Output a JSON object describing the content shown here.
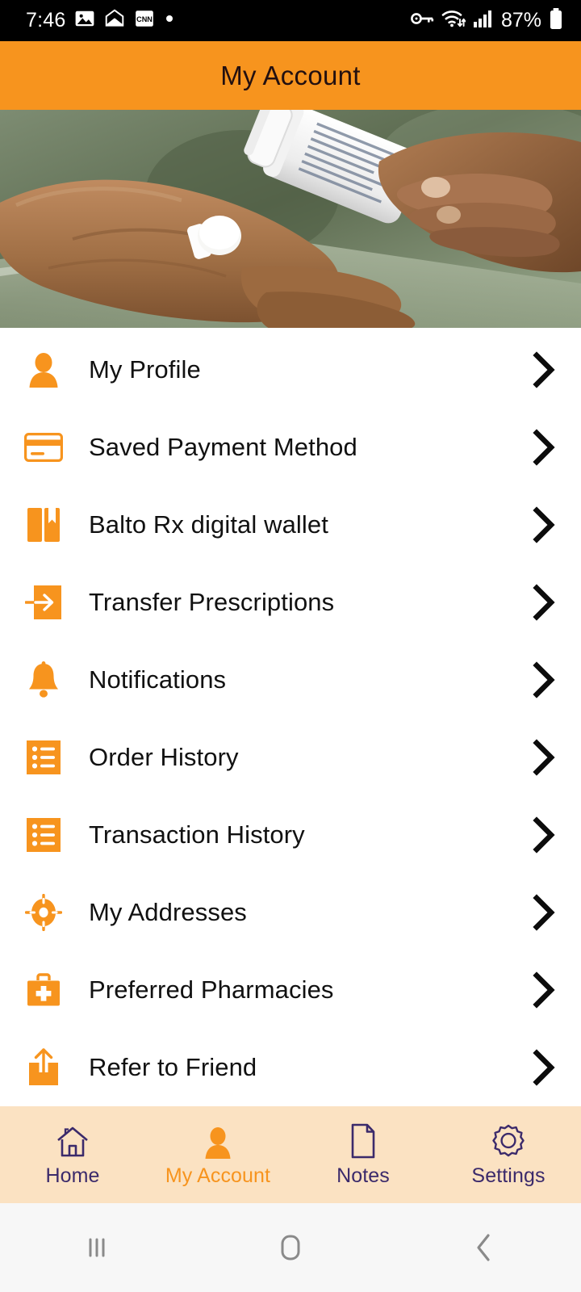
{
  "status_bar": {
    "time": "7:46",
    "battery_percent": "87%",
    "left_icons": [
      "image-icon",
      "envelope-icon",
      "cnn-icon",
      "dot-icon"
    ],
    "right_icons": [
      "vpn-key-icon",
      "wifi-icon",
      "cellular-signal-icon",
      "battery-icon"
    ]
  },
  "header": {
    "title": "My Account"
  },
  "hero": {
    "alt": "hands-pouring-pills-from-bottle-photo"
  },
  "menu": {
    "items": [
      {
        "label": "My Profile",
        "icon": "person-icon",
        "chevron": "chevron-right-icon"
      },
      {
        "label": "Saved Payment Method",
        "icon": "credit-card-icon",
        "chevron": "chevron-right-icon"
      },
      {
        "label": "Balto Rx digital wallet",
        "icon": "wallet-book-icon",
        "chevron": "chevron-right-icon"
      },
      {
        "label": "Transfer Prescriptions",
        "icon": "arrow-in-box-icon",
        "chevron": "chevron-right-icon"
      },
      {
        "label": "Notifications",
        "icon": "bell-icon",
        "chevron": "chevron-right-icon"
      },
      {
        "label": "Order History",
        "icon": "list-icon",
        "chevron": "chevron-right-icon"
      },
      {
        "label": "Transaction History",
        "icon": "list-icon",
        "chevron": "chevron-right-icon"
      },
      {
        "label": "My Addresses",
        "icon": "location-target-icon",
        "chevron": "chevron-right-icon"
      },
      {
        "label": "Preferred Pharmacies",
        "icon": "medical-kit-icon",
        "chevron": "chevron-right-icon"
      },
      {
        "label": "Refer to Friend",
        "icon": "share-upload-icon",
        "chevron": "chevron-right-icon"
      }
    ]
  },
  "tab_bar": {
    "tabs": [
      {
        "label": "Home",
        "icon": "home-icon",
        "active": false
      },
      {
        "label": "My Account",
        "icon": "person-icon",
        "active": true
      },
      {
        "label": "Notes",
        "icon": "document-icon",
        "active": false
      },
      {
        "label": "Settings",
        "icon": "gear-icon",
        "active": false
      }
    ]
  },
  "android_nav": {
    "buttons": [
      "recents-icon",
      "home-square-icon",
      "back-icon"
    ]
  },
  "colors": {
    "brand_orange": "#F7941E",
    "tab_bar_bg": "#FBE2C2",
    "tab_inactive": "#3B2A6B",
    "status_bar_bg": "#000000",
    "text_primary": "#111111"
  }
}
